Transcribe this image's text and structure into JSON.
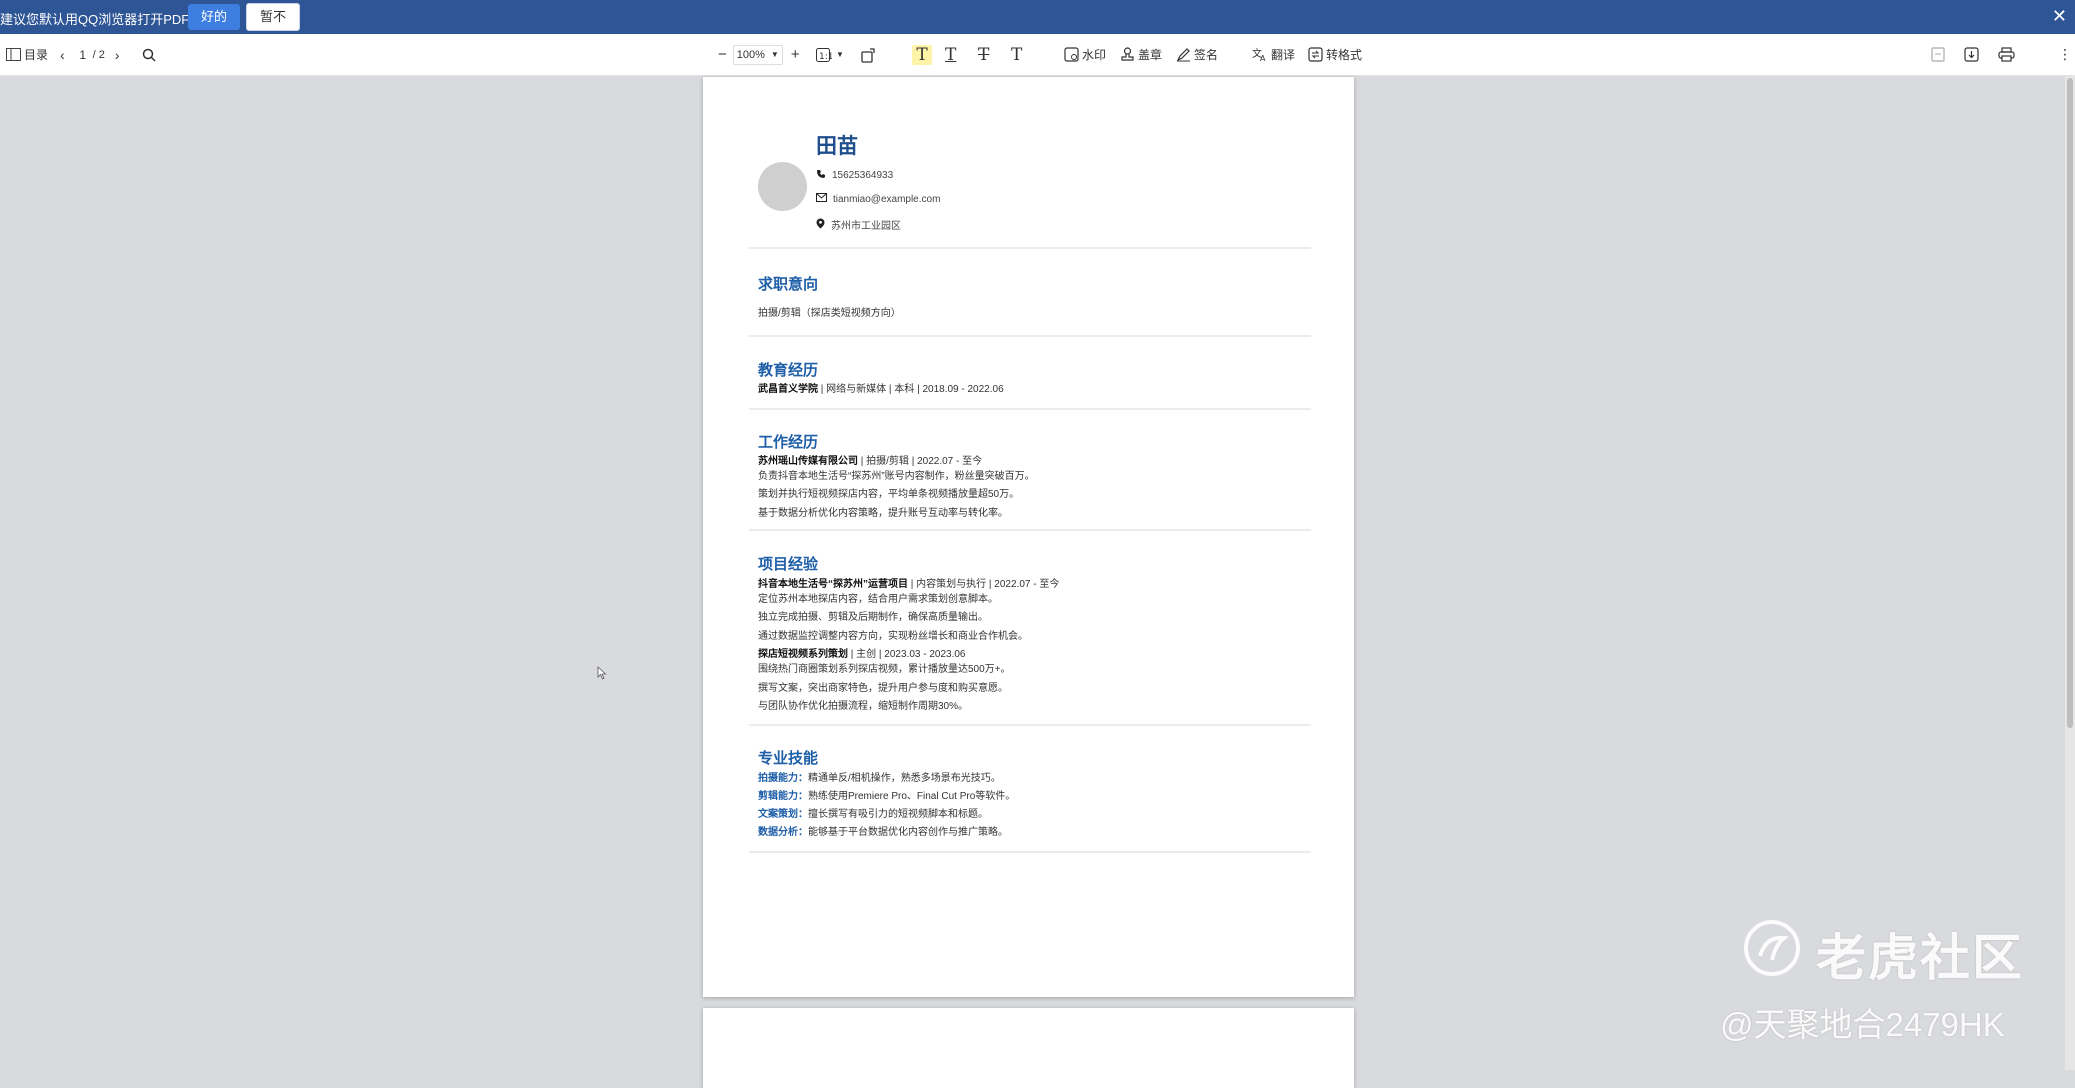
{
  "notification": {
    "message": "建议您默认用QQ浏览器打开PDF文件",
    "accept_label": "好的",
    "decline_label": "暂不",
    "close_icon": "close-icon"
  },
  "toolbar": {
    "toc_label": "目录",
    "current_page": "1",
    "total_pages": "/ 2",
    "zoom": "100%",
    "watermark_label": "水印",
    "stamp_label": "盖章",
    "sign_label": "签名",
    "translate_label": "翻译",
    "convert_label": "转格式"
  },
  "resume": {
    "name": "田苗",
    "phone": "15625364933",
    "email": "tianmiao@example.com",
    "location": "苏州市工业园区",
    "intent": {
      "title": "求职意向",
      "text": "拍摄/剪辑（探店类短视频方向）"
    },
    "education": {
      "title": "教育经历",
      "school": "武昌首义学院",
      "detail": " | 网络与新媒体 | 本科 | 2018.09 - 2022.06"
    },
    "work": {
      "title": "工作经历",
      "company": "苏州瑶山传媒有限公司",
      "detail": " | 拍摄/剪辑 | 2022.07 - 至今",
      "bullets": [
        "负责抖音本地生活号“探苏州”账号内容制作，粉丝量突破百万。",
        "策划并执行短视频探店内容，平均单条视频播放量超50万。",
        "基于数据分析优化内容策略，提升账号互动率与转化率。"
      ]
    },
    "projects": {
      "title": "项目经验",
      "p1_name": "抖音本地生活号“探苏州”运营项目",
      "p1_detail": " | 内容策划与执行 | 2022.07 - 至今",
      "p1_bullets": [
        "定位苏州本地探店内容，结合用户需求策划创意脚本。",
        "独立完成拍摄、剪辑及后期制作，确保高质量输出。",
        "通过数据监控调整内容方向，实现粉丝增长和商业合作机会。"
      ],
      "p2_name": "探店短视频系列策划",
      "p2_detail": " | 主创 | 2023.03 - 2023.06",
      "p2_bullets": [
        "围绕热门商圈策划系列探店视频，累计播放量达500万+。",
        "撰写文案，突出商家特色，提升用户参与度和购买意愿。",
        "与团队协作优化拍摄流程，缩短制作周期30%。"
      ]
    },
    "skills": {
      "title": "专业技能",
      "items": [
        {
          "k": "拍摄能力：",
          "v": "精通单反/相机操作，熟悉多场景布光技巧。"
        },
        {
          "k": "剪辑能力：",
          "v": "熟练使用Premiere Pro、Final Cut Pro等软件。"
        },
        {
          "k": "文案策划：",
          "v": "擅长撰写有吸引力的短视频脚本和标题。"
        },
        {
          "k": "数据分析：",
          "v": "能够基于平台数据优化内容创作与推广策略。"
        }
      ]
    }
  },
  "watermark": {
    "brand": "老虎社区",
    "handle": "@天聚地合2479HK"
  }
}
